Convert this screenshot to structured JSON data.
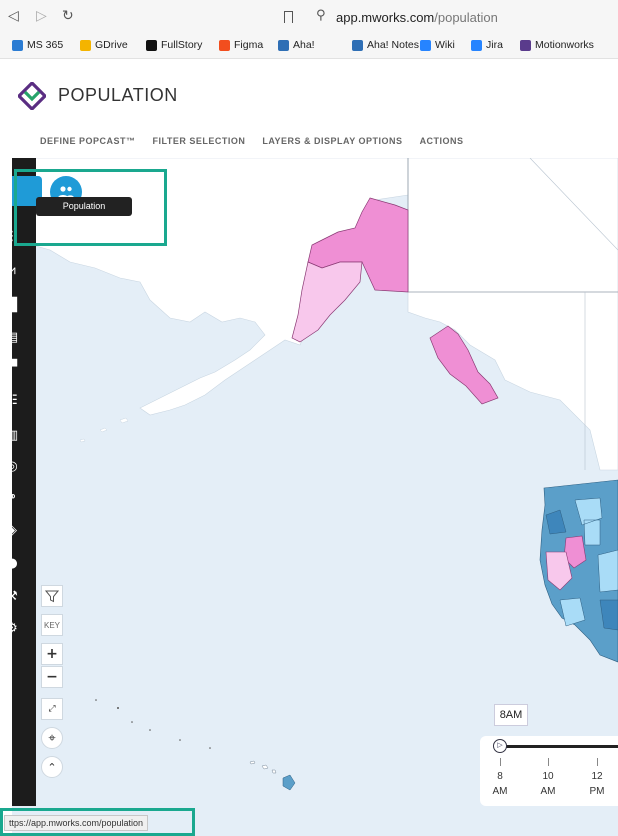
{
  "browser": {
    "url_host": "app.mworks.com",
    "url_path": "/population",
    "nav_icons": [
      "back-icon",
      "forward-icon",
      "reload-icon"
    ],
    "bookmarks": [
      {
        "label": "MS 365",
        "color": "#2b7cd3"
      },
      {
        "label": "GDrive",
        "color": "#f4b400"
      },
      {
        "label": "FullStory",
        "color": "#111111"
      },
      {
        "label": "Figma",
        "color": "#f24e1e"
      },
      {
        "label": "Aha!",
        "color": "#2f6fb5"
      },
      {
        "label": "Aha! Notes",
        "color": "#2f6fb5"
      },
      {
        "label": "Wiki",
        "color": "#2684ff"
      },
      {
        "label": "Jira",
        "color": "#2684ff"
      },
      {
        "label": "Motionworks",
        "color": "#5a3b8c"
      }
    ]
  },
  "app": {
    "title": "POPULATION",
    "nav": [
      "DEFINE POPCAST™",
      "FILTER SELECTION",
      "LAYERS & DISPLAY OPTIONS",
      "ACTIONS"
    ],
    "brand_colors": {
      "purple": "#5a2d82",
      "green": "#27a36a",
      "blue": "#1f9bd7"
    }
  },
  "tooltip": {
    "label": "Population"
  },
  "map": {
    "controls": {
      "key_label": "KEY",
      "zoom_in": "+",
      "zoom_out": "−"
    },
    "colors": {
      "water": "#e4eef7",
      "land": "#ffffff",
      "pink_dark": "#ef8fd4",
      "pink_light": "#f8c8ec",
      "blue_dark": "#5b9fc9",
      "blue_light": "#a9dcf7"
    }
  },
  "time": {
    "current": "8AM",
    "ticks": [
      {
        "hour": "8",
        "period": "AM"
      },
      {
        "hour": "10",
        "period": "AM"
      },
      {
        "hour": "12",
        "period": "PM"
      }
    ]
  },
  "status_url": "ttps://app.mworks.com/population"
}
